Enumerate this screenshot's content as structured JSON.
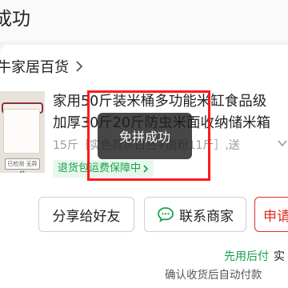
{
  "header": {
    "title": "成功"
  },
  "store": {
    "name": "牛家居百货"
  },
  "product": {
    "title_line1": "家用50斤装米桶多功能米缸食品级",
    "title_line2": "加厚30斤20斤防虫米面收纳储米箱",
    "spec": "15斤［实色款灰白色+面粉11斤］,送",
    "guarantee": "退货包运费保障中",
    "thumb_badge": "已检测 无异味"
  },
  "actions": {
    "share": "分享给好友",
    "contact": "联系商家",
    "apply": "申请"
  },
  "payment": {
    "pay_later": "先用后付",
    "pay_later_suffix": "实",
    "auto_pay_note": "确认收货后自动付款"
  },
  "toast": {
    "message": "免拼成功"
  },
  "colors": {
    "accent_green": "#16a34a",
    "accent_red": "#e02e24",
    "highlight": "#ff1a1a"
  },
  "icons": [
    "chevron-right-icon",
    "chevron-down-icon",
    "chat-bubble-icon"
  ]
}
